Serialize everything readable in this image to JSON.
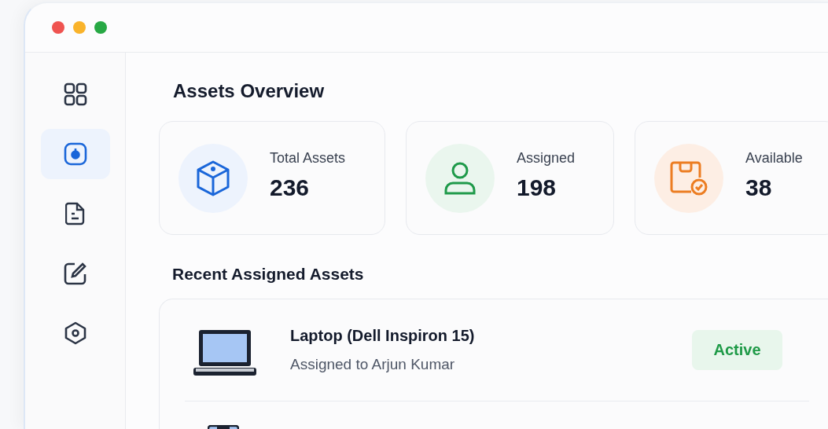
{
  "sidebar": {
    "items": [
      {
        "selected": false
      },
      {
        "selected": true
      },
      {
        "selected": false
      },
      {
        "selected": false
      },
      {
        "selected": false
      }
    ]
  },
  "overview": {
    "title": "Assets Overview",
    "stats": [
      {
        "label": "Total Assets",
        "value": "236"
      },
      {
        "label": "Assigned",
        "value": "198"
      },
      {
        "label": "Available",
        "value": "38"
      }
    ]
  },
  "recent": {
    "title": "Recent Assigned Assets",
    "items": [
      {
        "kind": "laptop",
        "name": "Laptop (Dell Inspiron 15)",
        "assignee": "Assigned to Arjun Kumar",
        "status": "Active"
      },
      {
        "kind": "device"
      }
    ]
  }
}
